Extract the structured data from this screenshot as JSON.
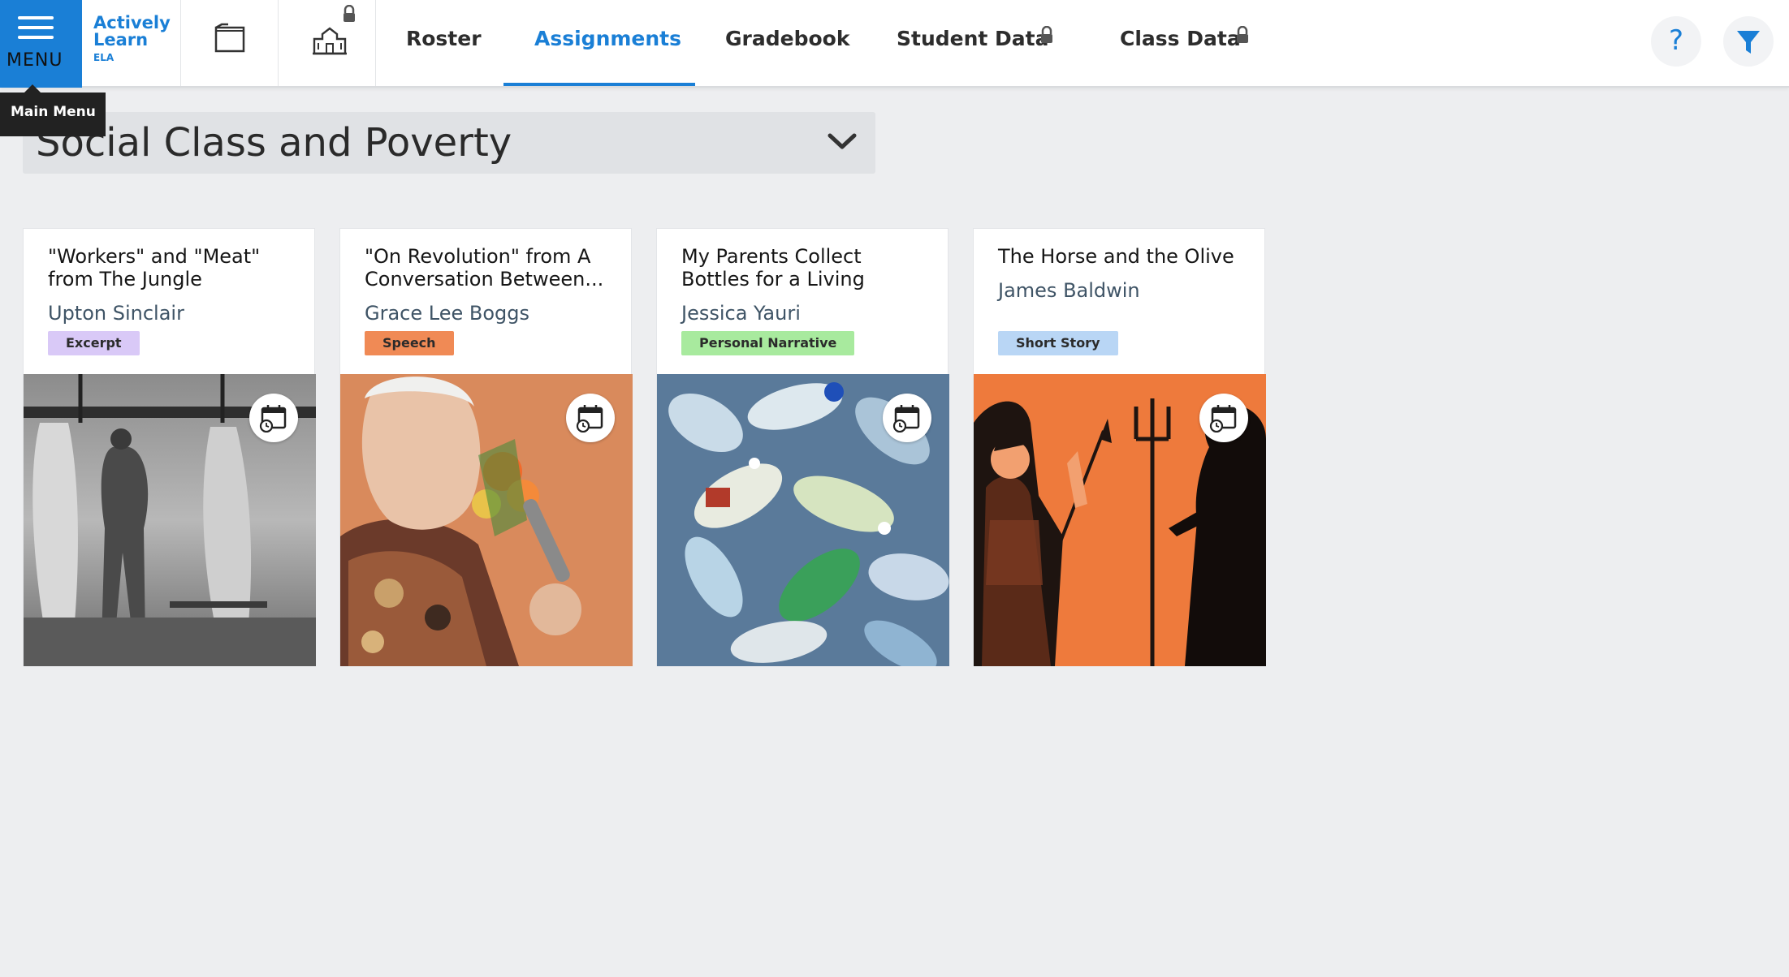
{
  "app": {
    "menu_label": "MENU",
    "logo_line1": "Actively",
    "logo_line2": "Learn",
    "logo_subject": "ELA",
    "tooltip": "Main Menu",
    "accent_color": "#1a7fd6"
  },
  "nav": {
    "tabs": [
      {
        "label": "Roster",
        "locked": false,
        "active": false
      },
      {
        "label": "Assignments",
        "locked": false,
        "active": true
      },
      {
        "label": "Gradebook",
        "locked": false,
        "active": false
      },
      {
        "label": "Student Data",
        "locked": true,
        "active": false
      },
      {
        "label": "Class Data",
        "locked": true,
        "active": false
      }
    ],
    "icons": [
      "menu-icon",
      "folder-icon",
      "school-icon",
      "lock-icon",
      "help-icon",
      "filter-icon"
    ],
    "help_label": "?"
  },
  "unit": {
    "title": "Social Class and Poverty"
  },
  "cards": [
    {
      "title_line1": "\"Workers\" and \"Meat\"",
      "title_line2": "from The Jungle",
      "author": "Upton Sinclair",
      "tag": "Excerpt",
      "tag_color": "#d9c9f7",
      "image": "black-and-white photo of worker among hanging carcasses"
    },
    {
      "title_line1": "\"On Revolution\" from A",
      "title_line2": "Conversation Between...",
      "author": "Grace Lee Boggs",
      "tag": "Speech",
      "tag_color": "#f08a55",
      "image": "elderly woman speaking into microphone holding flowers"
    },
    {
      "title_line1": "My Parents Collect",
      "title_line2": "Bottles for a Living",
      "author": "Jessica Yauri",
      "tag": "Personal Narrative",
      "tag_color": "#a8ea9e",
      "image": "pile of plastic bottles"
    },
    {
      "title_line1": "The Horse and the Olive",
      "title_line2": "",
      "author": "James Baldwin",
      "tag": "Short Story",
      "tag_color": "#b9d6f5",
      "image": "greek vase painting of Athena and Poseidon"
    }
  ]
}
